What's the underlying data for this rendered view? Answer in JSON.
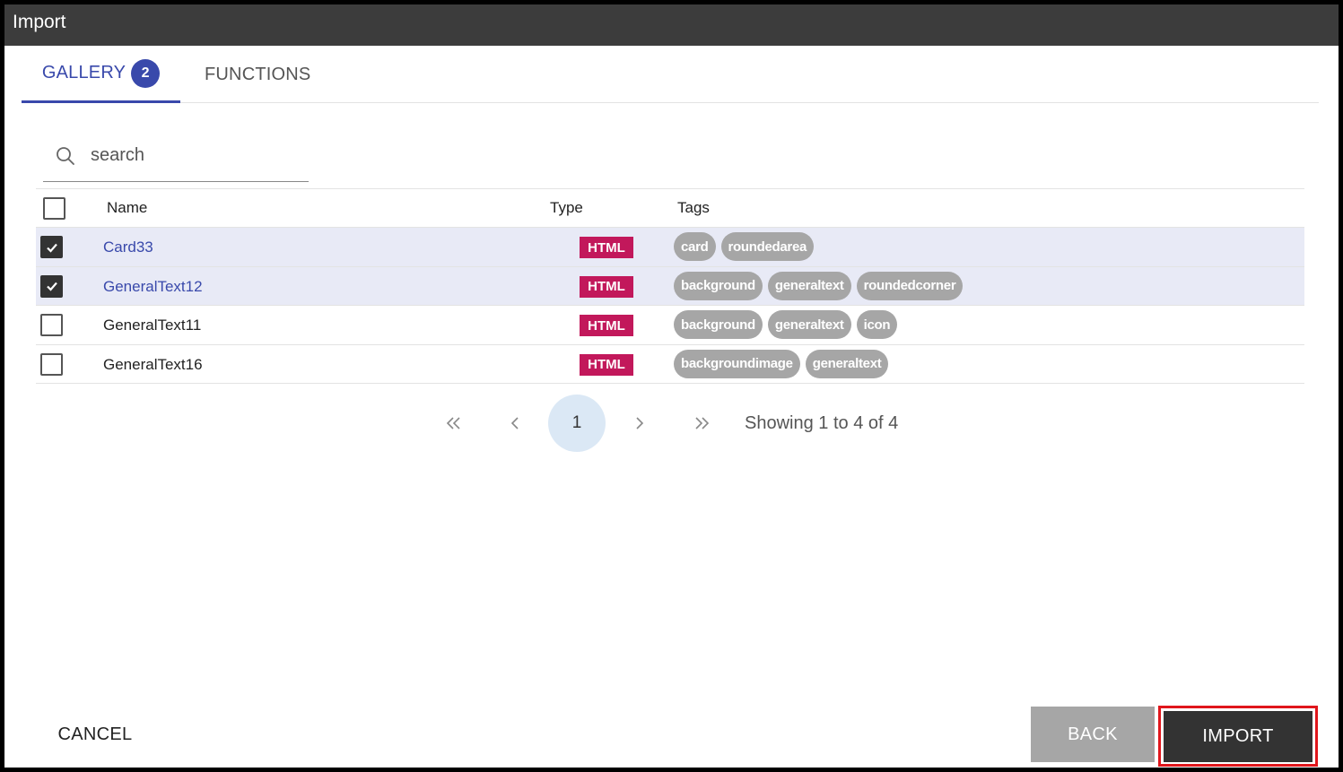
{
  "dialog": {
    "title": "Import"
  },
  "tabs": [
    {
      "label": "GALLERY",
      "badge": "2",
      "active": true
    },
    {
      "label": "FUNCTIONS",
      "active": false
    }
  ],
  "search": {
    "placeholder": "search",
    "value": "",
    "icon": "search-icon"
  },
  "table": {
    "columns": {
      "name": "Name",
      "type": "Type",
      "tags": "Tags"
    },
    "rows": [
      {
        "name": "Card33",
        "type": "HTML",
        "checked": true,
        "tags": [
          "card",
          "roundedarea"
        ]
      },
      {
        "name": "GeneralText12",
        "type": "HTML",
        "checked": true,
        "tags": [
          "background",
          "generaltext",
          "roundedcorner"
        ]
      },
      {
        "name": "GeneralText11",
        "type": "HTML",
        "checked": false,
        "tags": [
          "background",
          "generaltext",
          "icon"
        ]
      },
      {
        "name": "GeneralText16",
        "type": "HTML",
        "checked": false,
        "tags": [
          "backgroundimage",
          "generaltext"
        ]
      }
    ]
  },
  "pagination": {
    "current_page": "1",
    "info": "Showing 1 to 4 of 4"
  },
  "actions": {
    "cancel": "CANCEL",
    "back": "BACK",
    "import": "IMPORT"
  },
  "colors": {
    "accent": "#3949ab",
    "type_badge": "#c2185b",
    "tag": "#a6a6a6",
    "titlebar": "#3c3c3c",
    "selected_row": "#e8eaf6",
    "highlight_outline": "#e0161c"
  }
}
